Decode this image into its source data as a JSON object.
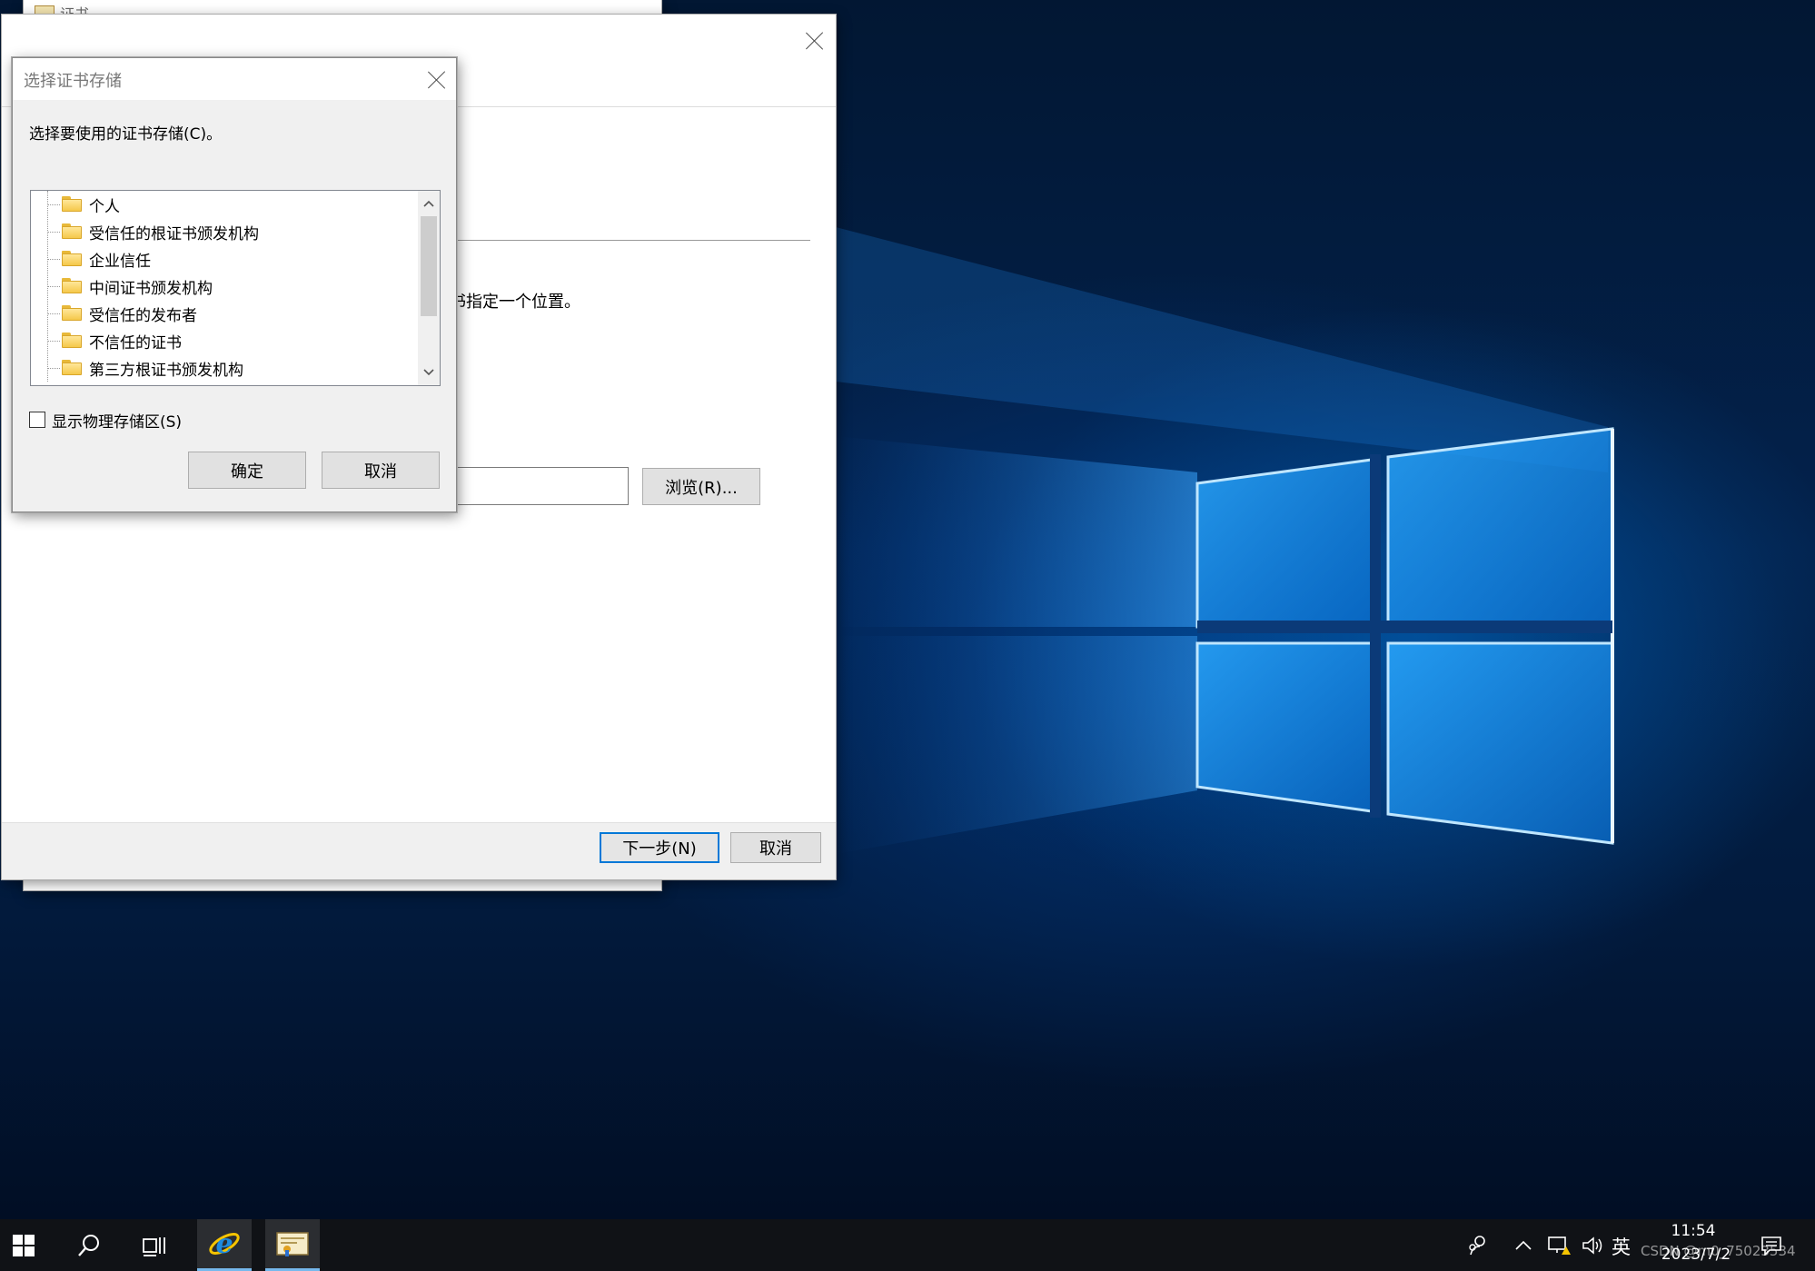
{
  "back_window": {
    "title": "证书"
  },
  "wizard": {
    "description_fragment": "书指定一个位置。",
    "browse_label": "浏览(R)...",
    "next_label": "下一步(N)",
    "cancel_label": "取消"
  },
  "dialog": {
    "title": "选择证书存储",
    "prompt": "选择要使用的证书存储(C)。",
    "stores": [
      {
        "label": "个人"
      },
      {
        "label": "受信任的根证书颁发机构"
      },
      {
        "label": "企业信任"
      },
      {
        "label": "中间证书颁发机构"
      },
      {
        "label": "受信任的发布者"
      },
      {
        "label": "不信任的证书"
      },
      {
        "label": "第三方根证书颁发机构"
      }
    ],
    "show_physical_label": "显示物理存储区(S)",
    "show_physical_checked": false,
    "ok_label": "确定",
    "cancel_label": "取消"
  },
  "taskbar": {
    "apps": [
      "start-icon",
      "search-icon",
      "task-view-icon",
      "internet-explorer-icon",
      "certificate-manager-icon"
    ],
    "tray": {
      "language": "英",
      "time": "11:54",
      "date": "2023/7/2",
      "watermark": "CSDN @m0_75023534"
    }
  },
  "colors": {
    "accent": "#0078d7",
    "taskbar": "#101216",
    "dialog_bg": "#f0f0f0"
  }
}
